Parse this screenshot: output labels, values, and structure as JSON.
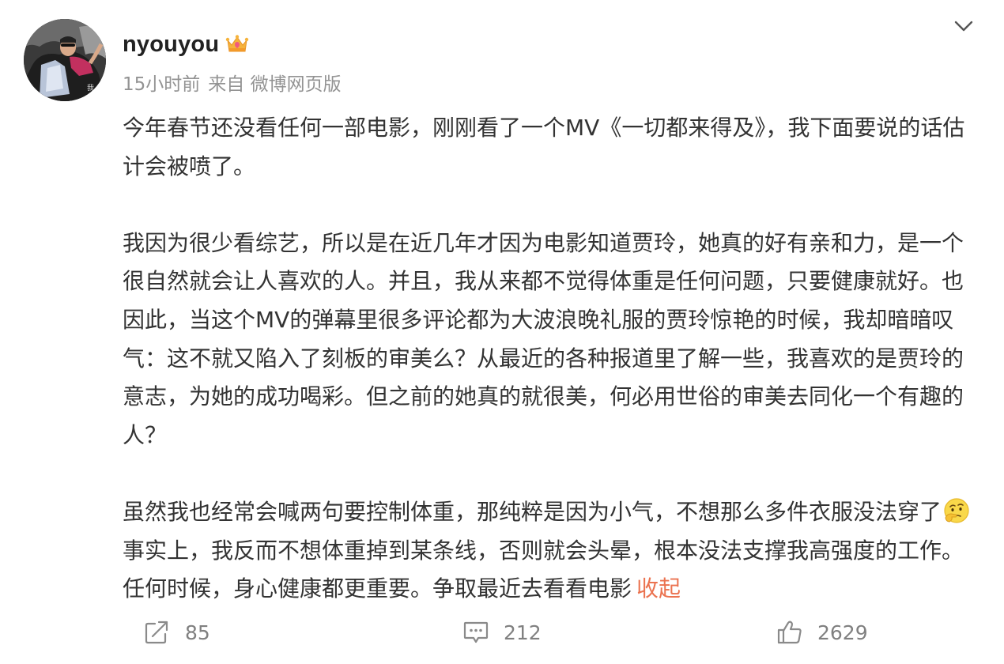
{
  "post": {
    "username": "nyouyou",
    "time": "15小时前",
    "source": "来自 微博网页版",
    "paragraphs": [
      {
        "text": "今年春节还没看任何一部电影，刚刚看了一个MV《一切都来得及》，我下面要说的话估计会被喷了。"
      },
      {
        "text": "我因为很少看综艺，所以是在近几年才因为电影知道贾玲，她真的好有亲和力，是一个很自然就会让人喜欢的人。并且，我从来都不觉得体重是任何问题，只要健康就好。也因此，当这个MV的弹幕里很多评论都为大波浪晚礼服的贾玲惊艳的时候，我却暗暗叹气：这不就又陷入了刻板的审美么？从最近的各种报道里了解一些，我喜欢的是贾玲的意志，为她的成功喝彩。但之前的她真的就很美，何必用世俗的审美去同化一个有趣的人？"
      },
      {
        "text_before_emoji": "虽然我也经常会喊两句要控制体重，那纯粹是因为小气，不想那么多件衣服没法穿了",
        "emoji": "thinking-emoji",
        "text_after_emoji": "事实上，我反而不想体重掉到某条线，否则就会头晕，根本没法支撑我高强度的工作。任何时候，身心健康都更重要。争取最近去看看电影",
        "collapse_label": "收起"
      }
    ]
  },
  "actions": {
    "repost_count": "85",
    "comment_count": "212",
    "like_count": "2629"
  },
  "icons": {
    "badge": "crown-badge-icon",
    "menu": "chevron-down-icon",
    "repost": "repost-icon",
    "comment": "comment-icon",
    "like": "thumbs-up-icon"
  },
  "colors": {
    "link": "#eb7350",
    "meta": "#939393",
    "text": "#333333"
  }
}
